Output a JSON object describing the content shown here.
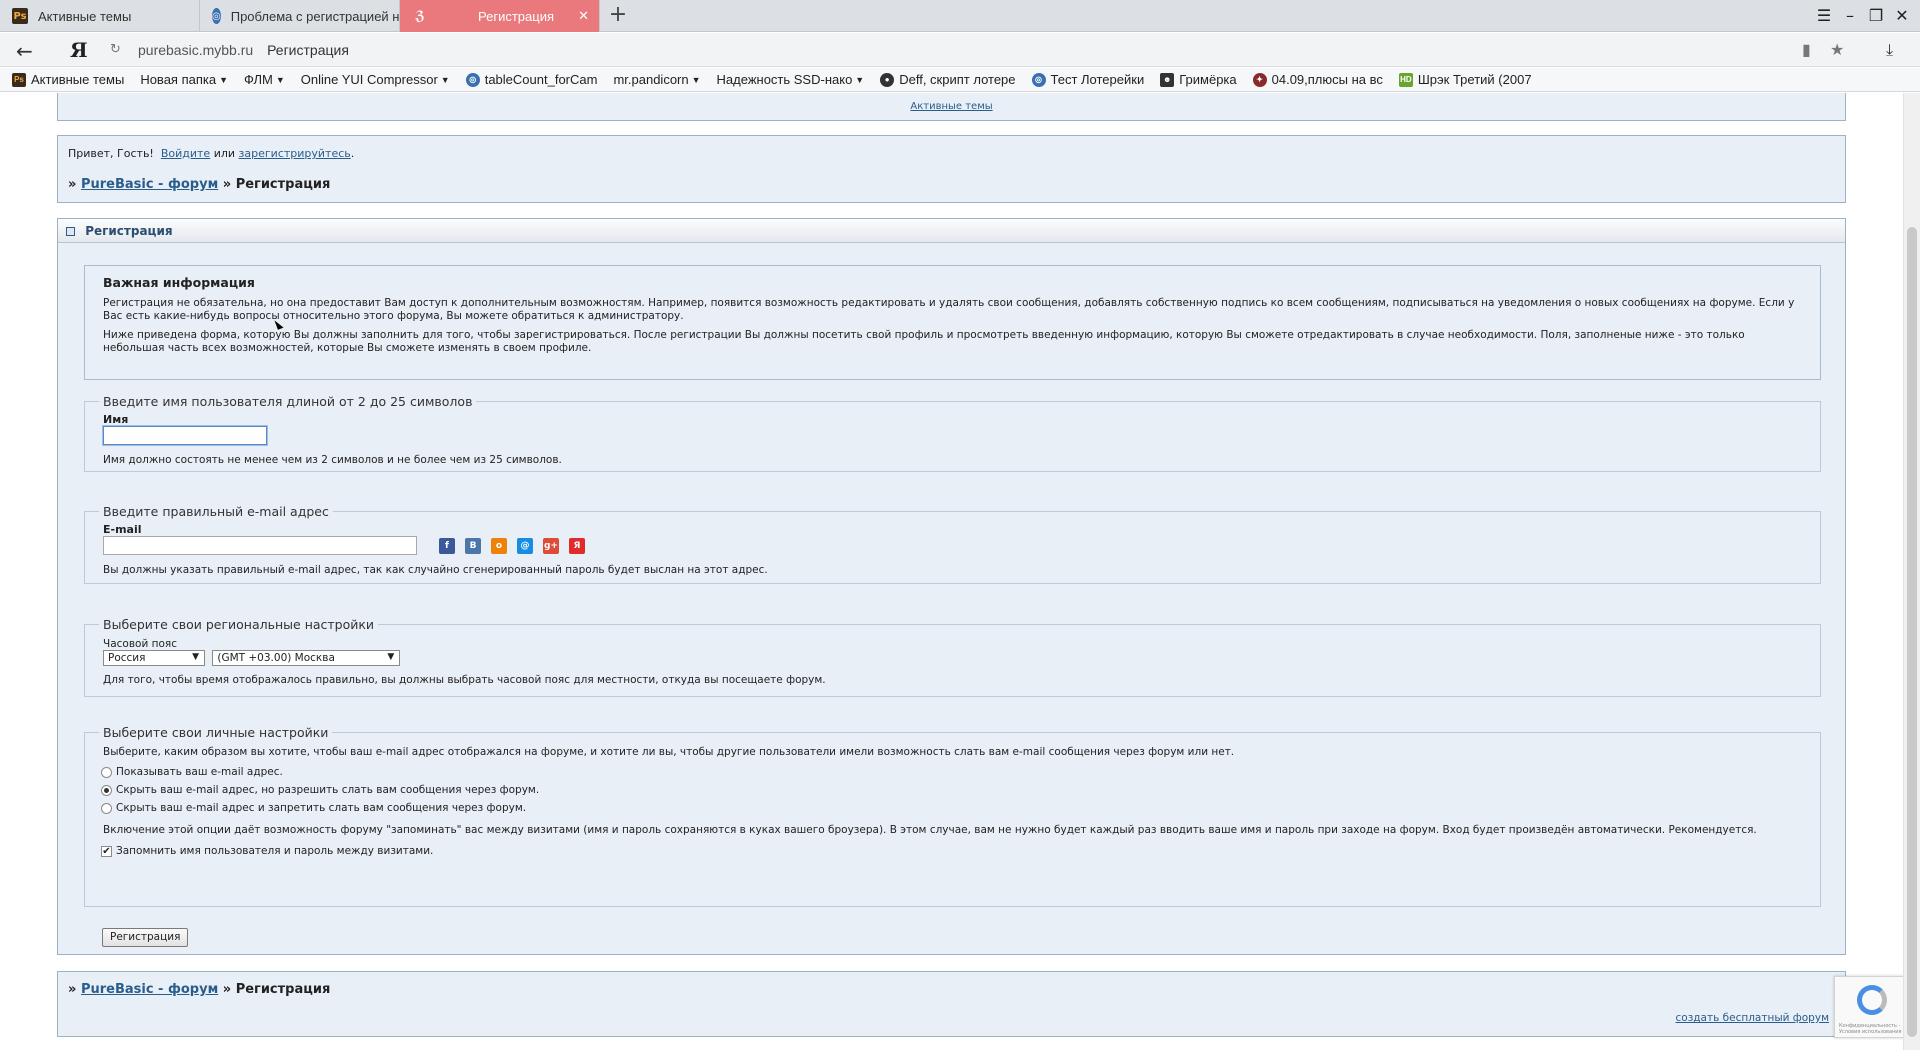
{
  "browser": {
    "tabs": [
      {
        "label": "Активные темы",
        "icon": "Ps",
        "color": "#3a2a1a"
      },
      {
        "label": "Проблема с регистрацией н",
        "icon": "globe",
        "color": "#3a6fb0"
      },
      {
        "label": "Регистрация",
        "icon": "Z",
        "color": "#e9797c",
        "active": true
      }
    ],
    "new_tab": "+",
    "url_host": "purebasic.mybb.ru",
    "url_title": "Регистрация",
    "bookmarks": [
      {
        "label": "Активные темы",
        "icon": "Ps",
        "color": "#3a2a1a"
      },
      {
        "label": "Новая папка",
        "caret": true
      },
      {
        "label": "ФЛМ",
        "caret": true
      },
      {
        "label": "Online YUI Compressor",
        "caret": true
      },
      {
        "label": "tableCount_forCam",
        "icon": "globe",
        "color": "#3a6fb0"
      },
      {
        "label": "mr.pandicorn",
        "caret": true
      },
      {
        "label": "Надежность SSD-нако",
        "caret": true
      },
      {
        "label": "Deff, скрипт лотере",
        "icon": "dd",
        "color": "#333"
      },
      {
        "label": "Тест Лотерейки",
        "icon": "globe",
        "color": "#3a6fb0"
      },
      {
        "label": "Гримёрка",
        "icon": "gr",
        "color": "#333"
      },
      {
        "label": "04.09,плюсы на вс",
        "icon": "gm",
        "color": "#8a2b2b"
      },
      {
        "label": "Шрэк Третий (2007",
        "icon": "HD",
        "color": "#6aa332"
      }
    ]
  },
  "forum": {
    "top_link": "Активные темы",
    "greeting_prefix": "Привет, Гость!",
    "login": "Войдите",
    "or": "или",
    "register": "зарегистрируйтесь",
    "crumb_sep": "»",
    "crumb_home": "PureBasic - форум",
    "crumb_current": "Регистрация",
    "section_title": "Регистрация",
    "info_title": "Важная информация",
    "info_p1": "Регистрация не обязательна, но она предоставит Вам доступ к дополнительным возможностям. Например, появится возможность редактировать и удалять свои сообщения, добавлять собственную подпись ко всем сообщениям, подписываться на уведомления о новых сообщениях на форуме. Если у Вас есть какие-нибудь вопросы относительно этого форума, Вы можете обратиться к администратору.",
    "info_p2": "Ниже приведена форма, которую Вы должны заполнить для того, чтобы зарегистрироваться. После регистрации Вы должны посетить свой профиль и просмотреть введенную информацию, которую Вы сможете отредактировать в случае необходимости. Поля, заполненые ниже - это только небольшая часть всех возможностей, которые Вы сможете изменять в своем профиле.",
    "username_legend": "Введите имя пользователя длиной от 2 до 25 символов",
    "username_label": "Имя",
    "username_value": "",
    "username_hint": "Имя должно состоять не менее чем из 2 символов и не более чем из 25 символов.",
    "email_legend": "Введите правильный e-mail адрес",
    "email_label": "E-mail",
    "email_value": "",
    "email_hint": "Вы должны указать правильный e-mail адрес, так как случайно сгенерированный пароль будет выслан на этот адрес.",
    "social_icons": [
      {
        "name": "facebook-icon",
        "glyph": "f",
        "color": "#3b5998"
      },
      {
        "name": "vkontakte-icon",
        "glyph": "B",
        "color": "#4a76a8"
      },
      {
        "name": "odnoklassniki-icon",
        "glyph": "o",
        "color": "#ee8208"
      },
      {
        "name": "mailru-icon",
        "glyph": "@",
        "color": "#168de2"
      },
      {
        "name": "googleplus-icon",
        "glyph": "g+",
        "color": "#dd4b39"
      },
      {
        "name": "yandex-icon",
        "glyph": "Я",
        "color": "#e12b2b"
      }
    ],
    "region_legend": "Выберите свои региональные настройки",
    "timezone_label": "Часовой пояс",
    "country_value": "Россия",
    "timezone_value": "(GMT +03.00) Москва",
    "region_hint": "Для того, чтобы время отображалось правильно, вы должны выбрать часовой пояс для местности, откуда вы посещаете форум.",
    "personal_legend": "Выберите свои личные настройки",
    "personal_intro": "Выберите, каким образом вы хотите, чтобы ваш e-mail адрес отображался на форуме, и хотите ли вы, чтобы другие пользователи имели возможность слать вам e-mail сообщения через форум или нет.",
    "radio_options": [
      {
        "label": "Показывать ваш e-mail адрес.",
        "checked": false
      },
      {
        "label": "Скрыть ваш e-mail адрес, но разрешить слать вам сообщения через форум.",
        "checked": true
      },
      {
        "label": "Скрыть ваш e-mail адрес и запретить слать вам сообщения через форум.",
        "checked": false
      }
    ],
    "remember_info": "Включение этой опции даёт возможность форуму \"запоминать\" вас между визитами (имя и пароль сохраняются в куках вашего броузера). В этом случае, вам не нужно будет каждый раз вводить ваше имя и пароль при заходе на форум. Вход будет произведён автоматически. Рекомендуется.",
    "remember_label": "Запомнить имя пользователя и пароль между визитами.",
    "remember_checked": true,
    "submit_label": "Регистрация",
    "free_forum": "создать бесплатный форум",
    "recaptcha_text": "Конфиденциальность - Условия использования"
  }
}
